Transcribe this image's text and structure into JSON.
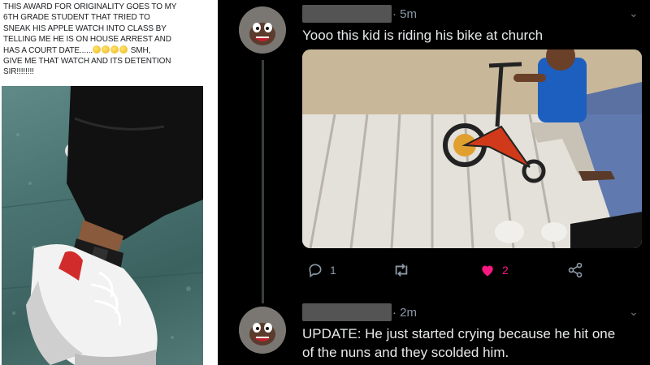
{
  "left_post": {
    "line1": "THIS AWARD FOR ORIGINALITY GOES TO MY",
    "line2": "6TH GRADE STUDENT THAT TRIED TO",
    "line3": "SNEAK HIS APPLE WATCH INTO CLASS BY",
    "line4": "TELLING ME HE IS ON HOUSE ARREST AND",
    "line5_a": "HAS A COURT DATE......",
    "line5_b": " SMH,",
    "line6": "GIVE ME THAT WATCH AND ITS DETENTION",
    "line7": "SIR!!!!!!!!"
  },
  "tweets": [
    {
      "time": "· 5m",
      "text": "Yooo this kid is riding his bike at church",
      "reply_count": "1",
      "retweet_count": "",
      "like_count": "2"
    },
    {
      "time": "· 2m",
      "text_line1": "UPDATE: He just started crying because he hit one",
      "text_line2": "of the nuns and they scolded him."
    }
  ],
  "colors": {
    "background": "#000000",
    "text": "#e7e9ea",
    "secondary": "#8b98a5",
    "like": "#f91880"
  },
  "icons": [
    "reply-icon",
    "retweet-icon",
    "like-icon",
    "share-icon",
    "chevron-down-icon"
  ]
}
